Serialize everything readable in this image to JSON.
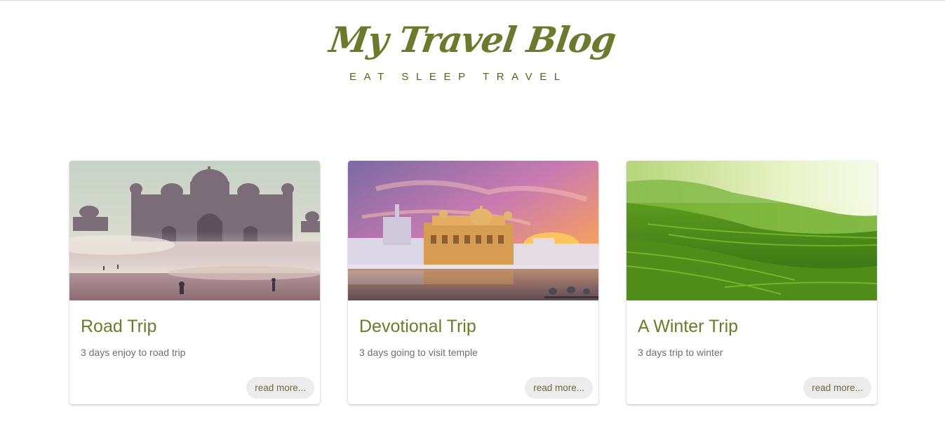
{
  "header": {
    "brand": "My Travel Blog",
    "tagline": "EAT SLEEP TRAVEL"
  },
  "cards": [
    {
      "title": "Road Trip",
      "description": "3 days enjoy to road trip",
      "button_label": "read more...",
      "image": "taj-mahal-fog-photo"
    },
    {
      "title": "Devotional Trip",
      "description": "3 days going to visit temple",
      "button_label": "read more...",
      "image": "golden-temple-sunset-photo"
    },
    {
      "title": "A Winter Trip",
      "description": "3 days trip to winter",
      "button_label": "read more...",
      "image": "tea-plantation-hills-photo"
    }
  ],
  "colors": {
    "accent": "#6b7b2e",
    "button_bg": "#ececec",
    "muted_text": "#6e6e6e"
  }
}
